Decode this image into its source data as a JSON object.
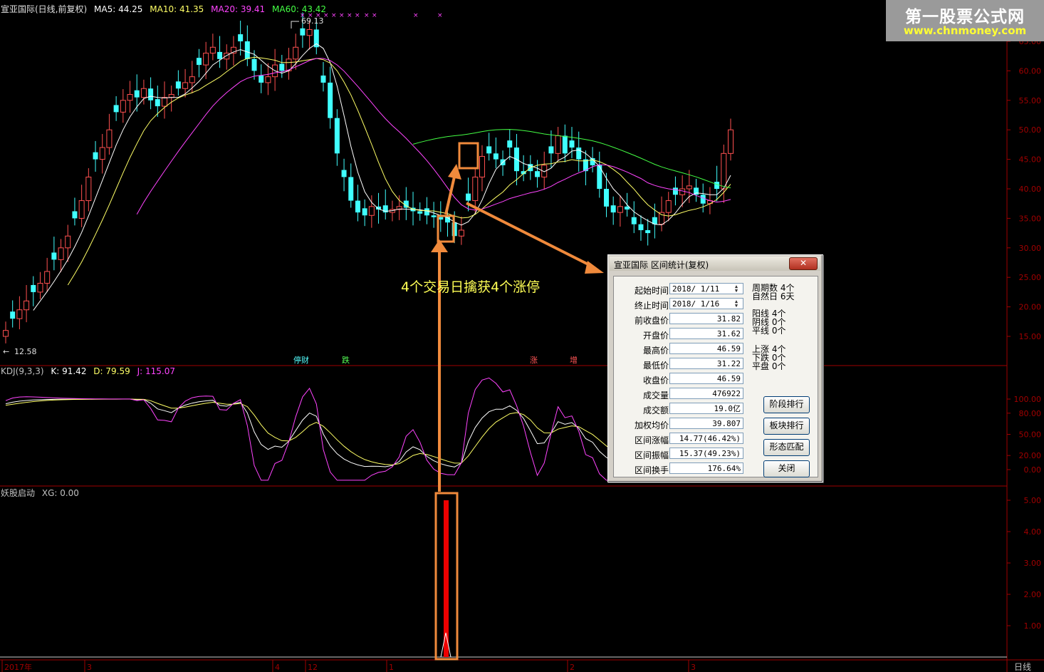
{
  "stock": {
    "title": "宣亚国际(日线,前复权)",
    "ma_legend": [
      {
        "label": "MA5: 44.25",
        "color": "#ffffff"
      },
      {
        "label": "MA10: 41.35",
        "color": "#ffff66"
      },
      {
        "label": "MA20: 39.41",
        "color": "#ff44ff"
      },
      {
        "label": "MA60: 43.42",
        "color": "#44ff44"
      }
    ],
    "high_label": "69.13",
    "low_label": "12.58",
    "price_axis": [
      "65.00",
      "60.00",
      "55.00",
      "50.00",
      "45.00",
      "40.00",
      "35.00",
      "30.00",
      "25.00",
      "20.00",
      "15.00"
    ],
    "events": [
      {
        "label": "停财",
        "color": "#55ffff"
      },
      {
        "label": "跌",
        "color": "#55ff55"
      },
      {
        "label": "涨",
        "color": "#ff5555"
      },
      {
        "label": "增",
        "color": "#ff5555"
      }
    ]
  },
  "kdj": {
    "legend": [
      {
        "label": "KDJ(9,3,3)",
        "color": "#c0c0c0"
      },
      {
        "label": "K: 91.42",
        "color": "#ffffff"
      },
      {
        "label": "D: 79.59",
        "color": "#ffff66"
      },
      {
        "label": "J: 115.07",
        "color": "#ff44ff"
      }
    ],
    "axis": [
      "100.00",
      "80.00",
      "50.00",
      "20.00",
      "0.00"
    ]
  },
  "indicator": {
    "legend": [
      {
        "label": "妖股启动",
        "color": "#c0c0c0"
      },
      {
        "label": "XG: 0.00",
        "color": "#c0c0c0"
      }
    ],
    "axis": [
      "5.00",
      "4.00",
      "3.00",
      "2.00",
      "1.00"
    ]
  },
  "timeline": {
    "labels": [
      "2017年",
      "3",
      "4",
      "12",
      "1",
      "2",
      "3"
    ]
  },
  "period_label": "日线",
  "annotation": "4个交易日擒获4个涨停",
  "watermark": {
    "title": "第一股票公式网",
    "url": "www.chnmoney.com"
  },
  "dialog": {
    "title": "宣亚国际 区间统计(复权)",
    "close_label": "✕",
    "fields": [
      {
        "label": "起始时间",
        "value": "2018/ 1/11",
        "date": true
      },
      {
        "label": "终止时间",
        "value": "2018/ 1/16",
        "date": true
      },
      {
        "label": "前收盘价",
        "value": "31.82"
      },
      {
        "label": "开盘价",
        "value": "31.62"
      },
      {
        "label": "最高价",
        "value": "46.59"
      },
      {
        "label": "最低价",
        "value": "31.22"
      },
      {
        "label": "收盘价",
        "value": "46.59"
      },
      {
        "label": "成交量",
        "value": "476922"
      },
      {
        "label": "成交额",
        "value": "19.0亿"
      },
      {
        "label": "加权均价",
        "value": "39.807"
      },
      {
        "label": "区间涨幅",
        "value": "14.77(46.42%)"
      },
      {
        "label": "区间振幅",
        "value": "15.37(49.23%)"
      },
      {
        "label": "区间换手",
        "value": "176.64%"
      }
    ],
    "side_stats": [
      [
        "周期数 4个",
        "自然日 6天"
      ],
      [
        "阳线 4个",
        "阴线 0个",
        "平线 0个"
      ],
      [
        "上涨 4个",
        "下跌 0个",
        "平盘 0个"
      ]
    ],
    "buttons": [
      "阶段排行",
      "板块排行",
      "形态匹配",
      "关闭"
    ]
  },
  "colors": {
    "up": "#ff5050",
    "down": "#40ffff",
    "axis": "#a00000"
  }
}
